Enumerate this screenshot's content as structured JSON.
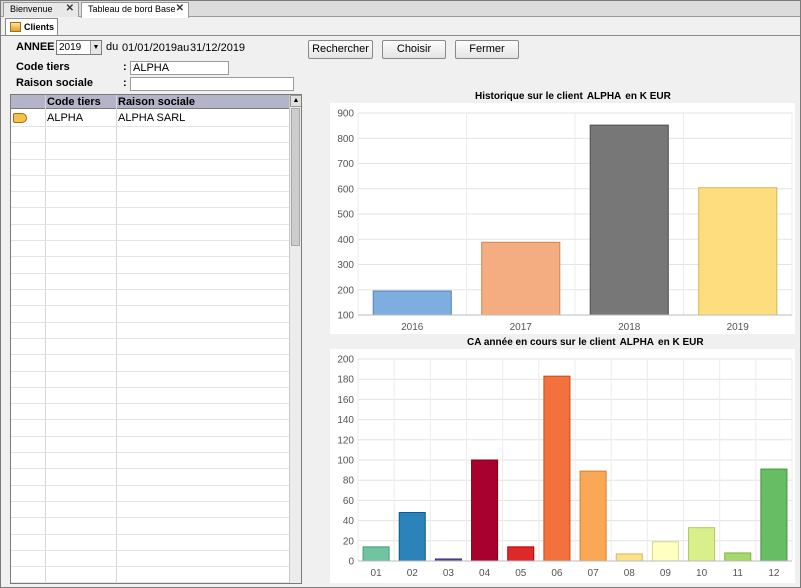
{
  "tabs": [
    {
      "label": "Bienvenue",
      "close": "✕"
    },
    {
      "label": "Tableau de bord Base",
      "close": "✕"
    }
  ],
  "subtab": {
    "label": "Clients"
  },
  "form": {
    "annee_label": "ANNEE :",
    "annee_value": "2019",
    "du_label": "du",
    "date_from": "01/01/2019",
    "au_label": "au",
    "date_to": "31/12/2019",
    "code_label": "Code tiers",
    "code_colon": ":",
    "code_value": "ALPHA",
    "raison_label": "Raison sociale",
    "raison_colon": ":",
    "raison_value": ""
  },
  "buttons": {
    "search": "Rechercher",
    "choose": "Choisir",
    "close": "Fermer"
  },
  "grid": {
    "headers": [
      "Code tiers",
      "Raison sociale"
    ],
    "rows": [
      {
        "code": "ALPHA",
        "raison": "ALPHA SARL"
      }
    ]
  },
  "chart1": {
    "title_pre": "Historique sur le client",
    "client": "ALPHA",
    "title_post": "en K EUR"
  },
  "chart2": {
    "title_pre": "CA année en cours sur le client",
    "client": "ALPHA",
    "title_post": "en K EUR"
  },
  "chart_data": [
    {
      "type": "bar",
      "title": "Historique sur le client ALPHA en K EUR",
      "categories": [
        "2016",
        "2017",
        "2018",
        "2019"
      ],
      "values": [
        195,
        388,
        852,
        604
      ],
      "colors": [
        "#7daee0",
        "#f4ad80",
        "#777777",
        "#fedd7e"
      ],
      "ylim": [
        100,
        900
      ],
      "yticks": [
        100,
        200,
        300,
        400,
        500,
        600,
        700,
        800,
        900
      ],
      "grid": true
    },
    {
      "type": "bar",
      "title": "CA année en cours sur le client ALPHA en K EUR",
      "categories": [
        "01",
        "02",
        "03",
        "04",
        "05",
        "06",
        "07",
        "08",
        "09",
        "10",
        "11",
        "12"
      ],
      "values": [
        14,
        48,
        2,
        100,
        14,
        183,
        89,
        7,
        19,
        33,
        8,
        91
      ],
      "colors": [
        "#6ec5a0",
        "#2b83ba",
        "#5e4fa2",
        "#a8002f",
        "#dd2928",
        "#f2713c",
        "#fba856",
        "#fee08b",
        "#ffffbf",
        "#d9ef8b",
        "#a6d96a",
        "#66bd63"
      ],
      "ylim": [
        0,
        200
      ],
      "yticks": [
        0,
        20,
        40,
        60,
        80,
        100,
        120,
        140,
        160,
        180,
        200
      ],
      "grid": true
    }
  ]
}
